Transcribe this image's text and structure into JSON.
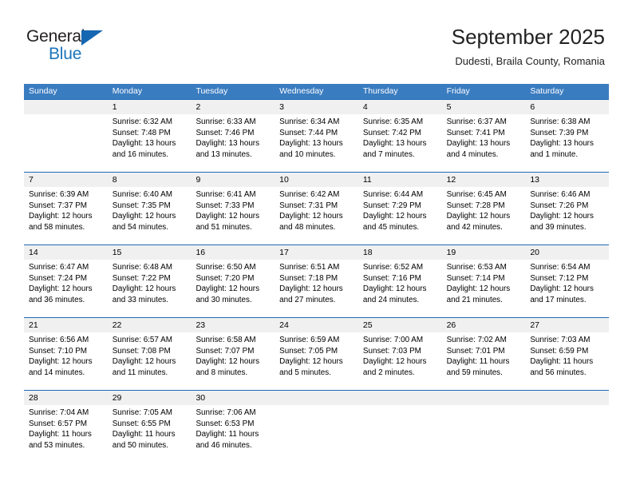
{
  "brand": {
    "name_part1": "General",
    "name_part2": "Blue",
    "logo_icon": "triangle-flag-icon"
  },
  "header": {
    "title": "September 2025",
    "subtitle": "Dudesti, Braila County, Romania"
  },
  "colors": {
    "header_blue": "#3a7cc0",
    "separator_blue": "#1d6cb5",
    "brand_blue": "#1b75bb",
    "number_band": "#f0f0f0"
  },
  "weekday_headers": [
    "Sunday",
    "Monday",
    "Tuesday",
    "Wednesday",
    "Thursday",
    "Friday",
    "Saturday"
  ],
  "weeks": [
    {
      "days": [
        {
          "num": "",
          "sunrise": "",
          "sunset": "",
          "daylight1": "",
          "daylight2": ""
        },
        {
          "num": "1",
          "sunrise": "Sunrise: 6:32 AM",
          "sunset": "Sunset: 7:48 PM",
          "daylight1": "Daylight: 13 hours",
          "daylight2": "and 16 minutes."
        },
        {
          "num": "2",
          "sunrise": "Sunrise: 6:33 AM",
          "sunset": "Sunset: 7:46 PM",
          "daylight1": "Daylight: 13 hours",
          "daylight2": "and 13 minutes."
        },
        {
          "num": "3",
          "sunrise": "Sunrise: 6:34 AM",
          "sunset": "Sunset: 7:44 PM",
          "daylight1": "Daylight: 13 hours",
          "daylight2": "and 10 minutes."
        },
        {
          "num": "4",
          "sunrise": "Sunrise: 6:35 AM",
          "sunset": "Sunset: 7:42 PM",
          "daylight1": "Daylight: 13 hours",
          "daylight2": "and 7 minutes."
        },
        {
          "num": "5",
          "sunrise": "Sunrise: 6:37 AM",
          "sunset": "Sunset: 7:41 PM",
          "daylight1": "Daylight: 13 hours",
          "daylight2": "and 4 minutes."
        },
        {
          "num": "6",
          "sunrise": "Sunrise: 6:38 AM",
          "sunset": "Sunset: 7:39 PM",
          "daylight1": "Daylight: 13 hours",
          "daylight2": "and 1 minute."
        }
      ]
    },
    {
      "days": [
        {
          "num": "7",
          "sunrise": "Sunrise: 6:39 AM",
          "sunset": "Sunset: 7:37 PM",
          "daylight1": "Daylight: 12 hours",
          "daylight2": "and 58 minutes."
        },
        {
          "num": "8",
          "sunrise": "Sunrise: 6:40 AM",
          "sunset": "Sunset: 7:35 PM",
          "daylight1": "Daylight: 12 hours",
          "daylight2": "and 54 minutes."
        },
        {
          "num": "9",
          "sunrise": "Sunrise: 6:41 AM",
          "sunset": "Sunset: 7:33 PM",
          "daylight1": "Daylight: 12 hours",
          "daylight2": "and 51 minutes."
        },
        {
          "num": "10",
          "sunrise": "Sunrise: 6:42 AM",
          "sunset": "Sunset: 7:31 PM",
          "daylight1": "Daylight: 12 hours",
          "daylight2": "and 48 minutes."
        },
        {
          "num": "11",
          "sunrise": "Sunrise: 6:44 AM",
          "sunset": "Sunset: 7:29 PM",
          "daylight1": "Daylight: 12 hours",
          "daylight2": "and 45 minutes."
        },
        {
          "num": "12",
          "sunrise": "Sunrise: 6:45 AM",
          "sunset": "Sunset: 7:28 PM",
          "daylight1": "Daylight: 12 hours",
          "daylight2": "and 42 minutes."
        },
        {
          "num": "13",
          "sunrise": "Sunrise: 6:46 AM",
          "sunset": "Sunset: 7:26 PM",
          "daylight1": "Daylight: 12 hours",
          "daylight2": "and 39 minutes."
        }
      ]
    },
    {
      "days": [
        {
          "num": "14",
          "sunrise": "Sunrise: 6:47 AM",
          "sunset": "Sunset: 7:24 PM",
          "daylight1": "Daylight: 12 hours",
          "daylight2": "and 36 minutes."
        },
        {
          "num": "15",
          "sunrise": "Sunrise: 6:48 AM",
          "sunset": "Sunset: 7:22 PM",
          "daylight1": "Daylight: 12 hours",
          "daylight2": "and 33 minutes."
        },
        {
          "num": "16",
          "sunrise": "Sunrise: 6:50 AM",
          "sunset": "Sunset: 7:20 PM",
          "daylight1": "Daylight: 12 hours",
          "daylight2": "and 30 minutes."
        },
        {
          "num": "17",
          "sunrise": "Sunrise: 6:51 AM",
          "sunset": "Sunset: 7:18 PM",
          "daylight1": "Daylight: 12 hours",
          "daylight2": "and 27 minutes."
        },
        {
          "num": "18",
          "sunrise": "Sunrise: 6:52 AM",
          "sunset": "Sunset: 7:16 PM",
          "daylight1": "Daylight: 12 hours",
          "daylight2": "and 24 minutes."
        },
        {
          "num": "19",
          "sunrise": "Sunrise: 6:53 AM",
          "sunset": "Sunset: 7:14 PM",
          "daylight1": "Daylight: 12 hours",
          "daylight2": "and 21 minutes."
        },
        {
          "num": "20",
          "sunrise": "Sunrise: 6:54 AM",
          "sunset": "Sunset: 7:12 PM",
          "daylight1": "Daylight: 12 hours",
          "daylight2": "and 17 minutes."
        }
      ]
    },
    {
      "days": [
        {
          "num": "21",
          "sunrise": "Sunrise: 6:56 AM",
          "sunset": "Sunset: 7:10 PM",
          "daylight1": "Daylight: 12 hours",
          "daylight2": "and 14 minutes."
        },
        {
          "num": "22",
          "sunrise": "Sunrise: 6:57 AM",
          "sunset": "Sunset: 7:08 PM",
          "daylight1": "Daylight: 12 hours",
          "daylight2": "and 11 minutes."
        },
        {
          "num": "23",
          "sunrise": "Sunrise: 6:58 AM",
          "sunset": "Sunset: 7:07 PM",
          "daylight1": "Daylight: 12 hours",
          "daylight2": "and 8 minutes."
        },
        {
          "num": "24",
          "sunrise": "Sunrise: 6:59 AM",
          "sunset": "Sunset: 7:05 PM",
          "daylight1": "Daylight: 12 hours",
          "daylight2": "and 5 minutes."
        },
        {
          "num": "25",
          "sunrise": "Sunrise: 7:00 AM",
          "sunset": "Sunset: 7:03 PM",
          "daylight1": "Daylight: 12 hours",
          "daylight2": "and 2 minutes."
        },
        {
          "num": "26",
          "sunrise": "Sunrise: 7:02 AM",
          "sunset": "Sunset: 7:01 PM",
          "daylight1": "Daylight: 11 hours",
          "daylight2": "and 59 minutes."
        },
        {
          "num": "27",
          "sunrise": "Sunrise: 7:03 AM",
          "sunset": "Sunset: 6:59 PM",
          "daylight1": "Daylight: 11 hours",
          "daylight2": "and 56 minutes."
        }
      ]
    },
    {
      "days": [
        {
          "num": "28",
          "sunrise": "Sunrise: 7:04 AM",
          "sunset": "Sunset: 6:57 PM",
          "daylight1": "Daylight: 11 hours",
          "daylight2": "and 53 minutes."
        },
        {
          "num": "29",
          "sunrise": "Sunrise: 7:05 AM",
          "sunset": "Sunset: 6:55 PM",
          "daylight1": "Daylight: 11 hours",
          "daylight2": "and 50 minutes."
        },
        {
          "num": "30",
          "sunrise": "Sunrise: 7:06 AM",
          "sunset": "Sunset: 6:53 PM",
          "daylight1": "Daylight: 11 hours",
          "daylight2": "and 46 minutes."
        },
        {
          "num": "",
          "sunrise": "",
          "sunset": "",
          "daylight1": "",
          "daylight2": ""
        },
        {
          "num": "",
          "sunrise": "",
          "sunset": "",
          "daylight1": "",
          "daylight2": ""
        },
        {
          "num": "",
          "sunrise": "",
          "sunset": "",
          "daylight1": "",
          "daylight2": ""
        },
        {
          "num": "",
          "sunrise": "",
          "sunset": "",
          "daylight1": "",
          "daylight2": ""
        }
      ]
    }
  ]
}
